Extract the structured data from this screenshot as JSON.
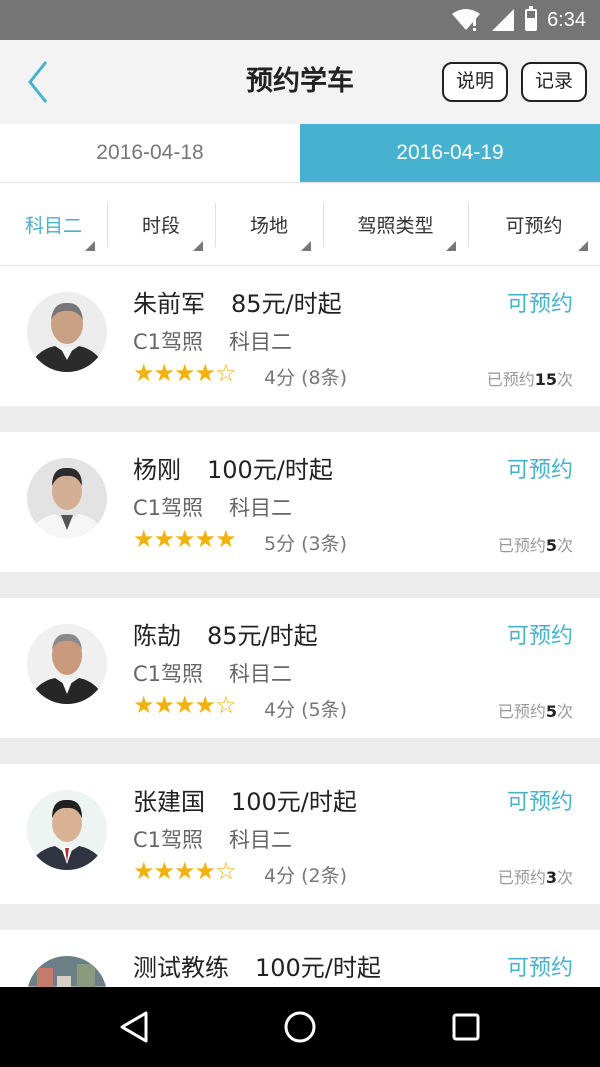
{
  "status_bar": {
    "time": "6:34"
  },
  "header": {
    "title": "预约学车",
    "explain_label": "说明",
    "records_label": "记录"
  },
  "date_tabs": [
    {
      "label": "2016-04-18",
      "active": false
    },
    {
      "label": "2016-04-19",
      "active": true
    }
  ],
  "filters": [
    {
      "label": "科目二",
      "selected": true
    },
    {
      "label": "时段",
      "selected": false
    },
    {
      "label": "场地",
      "selected": false
    },
    {
      "label": "驾照类型",
      "selected": false
    },
    {
      "label": "可预约",
      "selected": false
    }
  ],
  "coaches": [
    {
      "name": "朱前军",
      "price": "85元/时起",
      "license": "C1驾照",
      "subject": "科目二",
      "stars": 4,
      "rating": "4分 (8条)",
      "status": "可预约",
      "booked_prefix": "已预约",
      "booked_count": "15",
      "booked_suffix": "次"
    },
    {
      "name": "杨刚",
      "price": "100元/时起",
      "license": "C1驾照",
      "subject": "科目二",
      "stars": 5,
      "rating": "5分 (3条)",
      "status": "可预约",
      "booked_prefix": "已预约",
      "booked_count": "5",
      "booked_suffix": "次"
    },
    {
      "name": "陈劼",
      "price": "85元/时起",
      "license": "C1驾照",
      "subject": "科目二",
      "stars": 4,
      "rating": "4分 (5条)",
      "status": "可预约",
      "booked_prefix": "已预约",
      "booked_count": "5",
      "booked_suffix": "次"
    },
    {
      "name": "张建国",
      "price": "100元/时起",
      "license": "C1驾照",
      "subject": "科目二",
      "stars": 4,
      "rating": "4分 (2条)",
      "status": "可预约",
      "booked_prefix": "已预约",
      "booked_count": "3",
      "booked_suffix": "次"
    },
    {
      "name": "测试教练",
      "price": "100元/时起",
      "status": "可预约"
    }
  ],
  "colors": {
    "accent": "#46b2cf",
    "star": "#f2b20c",
    "status_bar": "#757575"
  },
  "icons": {
    "back": "back-chevron-icon",
    "wifi": "wifi-icon",
    "signal": "signal-icon",
    "battery": "battery-icon",
    "nav_back": "nav-back-icon",
    "nav_home": "nav-home-icon",
    "nav_recent": "nav-recent-icon"
  }
}
